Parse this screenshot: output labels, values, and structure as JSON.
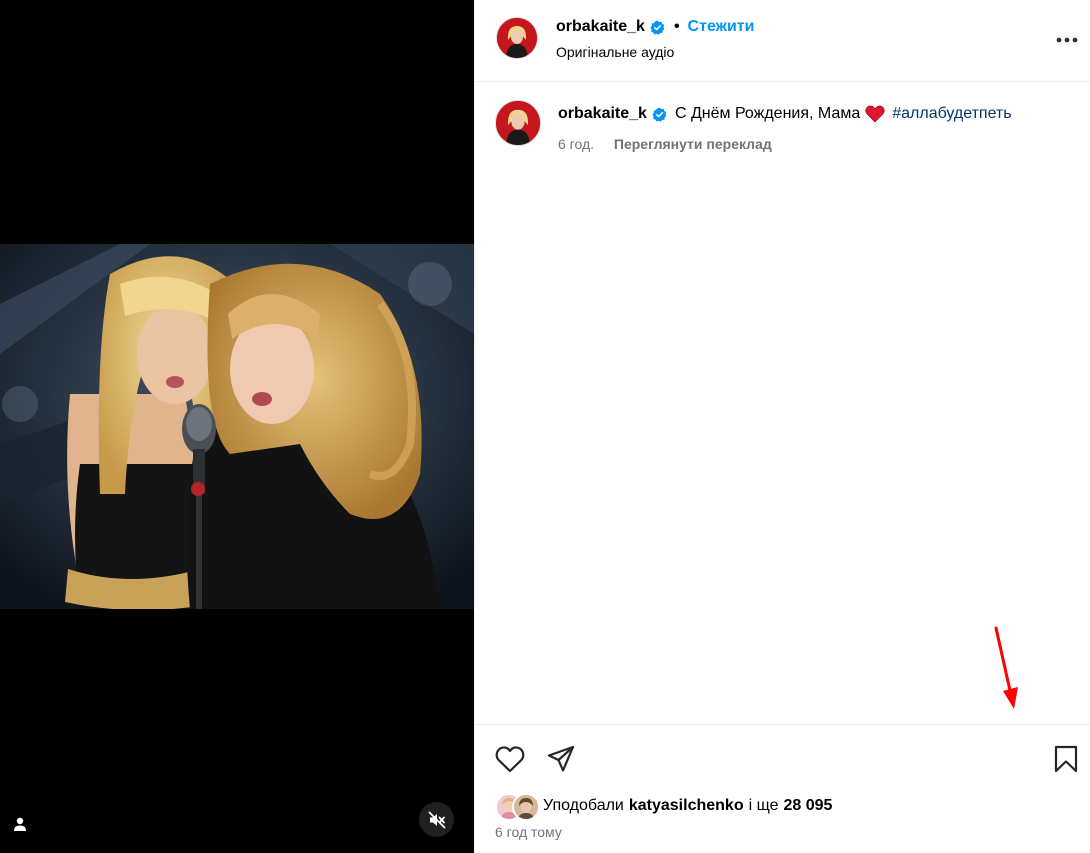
{
  "post": {
    "username": "orbakaite_k",
    "dot": "•",
    "follow_label": "Стежити",
    "audio_label": "Оригінальне аудіо"
  },
  "caption": {
    "username": "orbakaite_k",
    "text": "С Днём Рождения, Мама",
    "hashtag": "#аллабудетпеть",
    "time": "6 год.",
    "see_translation": "Переглянути переклад"
  },
  "likes": {
    "prefix": "Уподобали",
    "first_user": "katyasilchenko",
    "and_more": "і ще",
    "count": "28 095"
  },
  "timestamp": "6 год тому",
  "icons": {
    "more": "more-horizontal-icon",
    "like": "heart-outline-icon",
    "share": "paper-plane-icon",
    "save": "bookmark-icon",
    "mute": "speaker-muted-icon",
    "tag": "user-tag-icon",
    "verified": "verified-badge-icon"
  },
  "colors": {
    "accent": "#0095f6",
    "verified": "#0095f6",
    "hashtag": "#00376b",
    "heart_emoji": "#e0142b",
    "secondary_text": "#737373",
    "annotation_arrow": "#ff0000"
  }
}
